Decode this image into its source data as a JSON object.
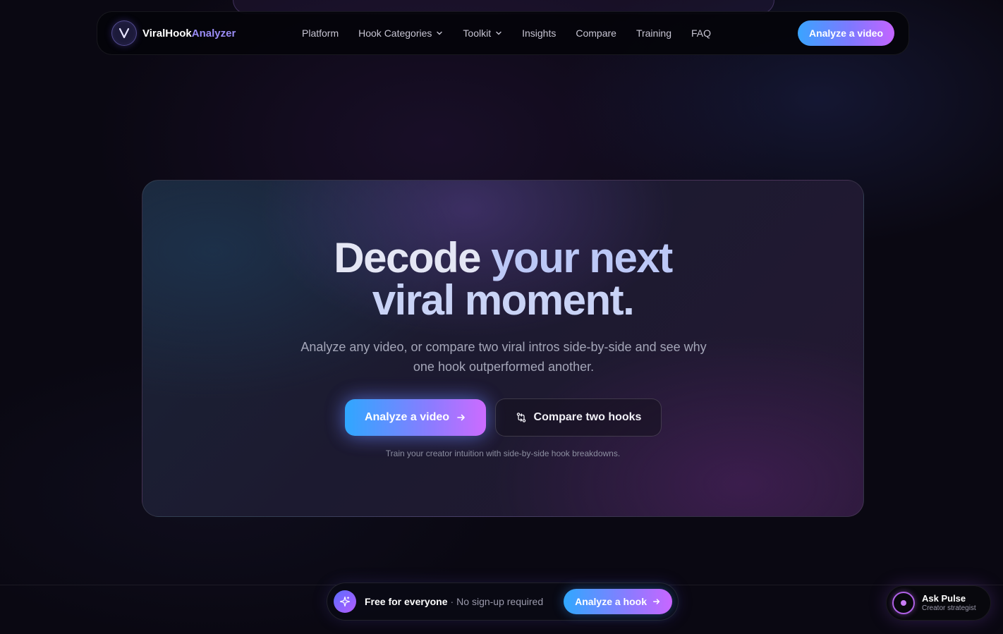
{
  "brand": {
    "name_main": "ViralHook",
    "name_accent": "Analyzer",
    "logo_letter": "V",
    "accent_color": "#9a8cf5"
  },
  "nav": {
    "links": [
      {
        "label": "Platform",
        "has_dropdown": false
      },
      {
        "label": "Hook Categories",
        "has_dropdown": true
      },
      {
        "label": "Toolkit",
        "has_dropdown": true
      },
      {
        "label": "Insights",
        "has_dropdown": false
      },
      {
        "label": "Compare",
        "has_dropdown": false
      },
      {
        "label": "Training",
        "has_dropdown": false
      },
      {
        "label": "FAQ",
        "has_dropdown": false
      }
    ],
    "cta_label": "Analyze a video"
  },
  "hero": {
    "title_line1_a": "Decode",
    "title_line1_b": "your next",
    "title_line2": "viral moment.",
    "subtitle": "Analyze any video, or compare two viral intros side-by-side and see why one hook outperformed another.",
    "primary_label": "Analyze a video",
    "secondary_label": "Compare two hooks",
    "note": "Train your creator intuition with side-by-side hook breakdowns."
  },
  "promo": {
    "bold": "Free for everyone",
    "separator": "·",
    "muted": "No sign-up required",
    "cta_label": "Analyze a hook"
  },
  "assistant": {
    "title": "Ask Pulse",
    "subtitle": "Creator strategist"
  },
  "colors": {
    "gradient_start": "#2fa7ff",
    "gradient_mid": "#8a7cff",
    "gradient_end": "#cc6bff",
    "background": "#0a0812"
  },
  "icons": {
    "logo": "v-logo-icon",
    "dropdown": "chevron-down-icon",
    "arrow": "arrow-right-icon",
    "compare": "compare-arrows-icon",
    "sparkle": "sparkle-icon",
    "pulse": "pulse-ring-icon"
  }
}
